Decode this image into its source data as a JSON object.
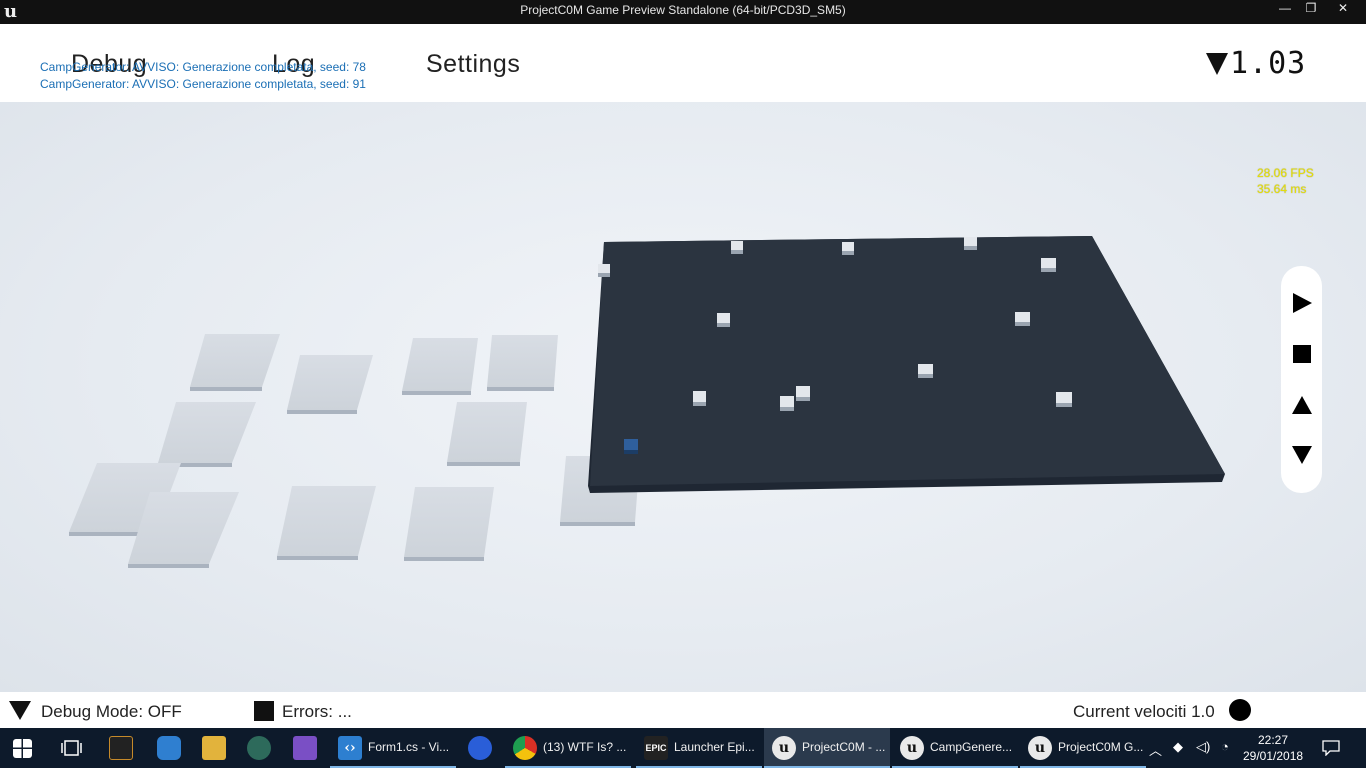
{
  "window": {
    "title": "ProjectC0M Game Preview Standalone (64-bit/PCD3D_SM5)",
    "buttons": [
      "—",
      "❐",
      "✕"
    ]
  },
  "menu": {
    "items": [
      "Debug",
      "Log",
      "Settings"
    ],
    "version": "1.03"
  },
  "log": {
    "lines": [
      "CampGenerator: AVVISO: Generazione completata, seed: 78",
      "CampGenerator: AVVISO: Generazione completata, seed: 91"
    ]
  },
  "stats": {
    "fps": "28.06 FPS",
    "ms": "35.64 ms",
    "color": "#e8e200"
  },
  "controls": {
    "icons": [
      "play-icon",
      "stop-icon",
      "up-arrow-icon",
      "down-arrow-icon"
    ]
  },
  "status": {
    "debug_mode": "Debug Mode: OFF",
    "errors": "Errors: ...",
    "velocity": "Current velociti 1.0"
  },
  "taskbar": {
    "apps": [
      {
        "label": "Form1.cs - Vi...",
        "icon": "vscode-icon"
      },
      {
        "label": "(13) WTF Is? ...",
        "icon": "chrome-icon"
      },
      {
        "label": "Launcher Epi...",
        "icon": "epic-icon"
      },
      {
        "label": "ProjectC0M - ...",
        "icon": "unreal-icon",
        "active": true
      },
      {
        "label": "CampGenere...",
        "icon": "unreal-icon"
      },
      {
        "label": "ProjectC0M G...",
        "icon": "unreal-icon"
      }
    ],
    "clock_time": "22:27",
    "clock_date": "29/01/2018"
  }
}
